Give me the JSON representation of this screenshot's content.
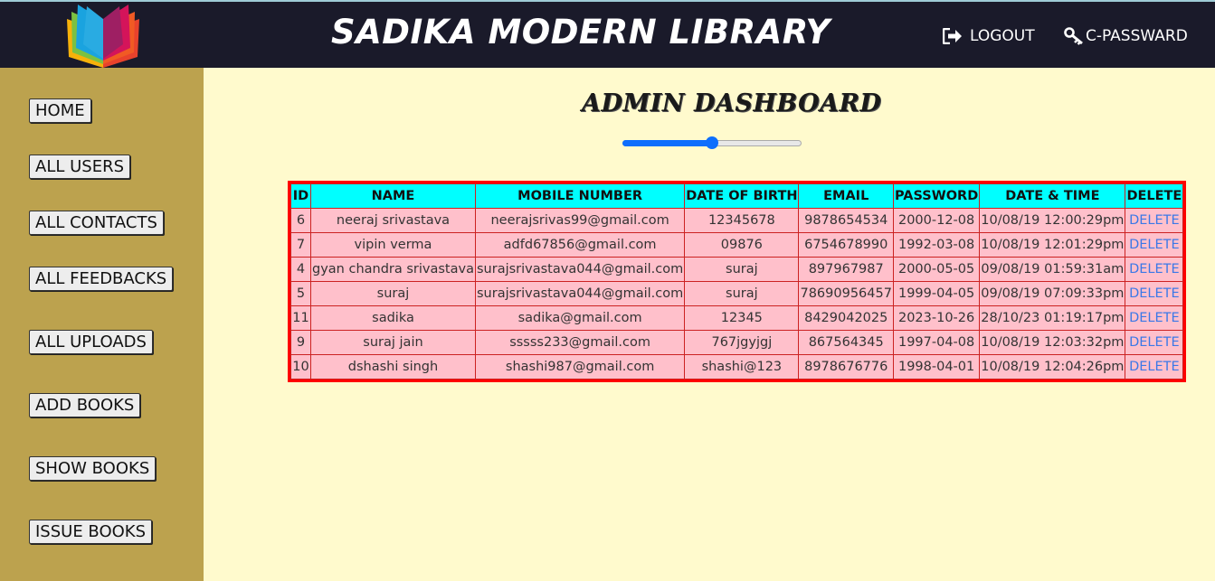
{
  "header": {
    "site_title": "SADIKA MODERN LIBRARY",
    "logout_label": "LOGOUT",
    "change_password_label": "C-PASSWARD"
  },
  "sidebar": {
    "items": [
      {
        "label": "HOME"
      },
      {
        "label": "ALL USERS"
      },
      {
        "label": "ALL CONTACTS"
      },
      {
        "label": "ALL FEEDBACKS"
      },
      {
        "label": "ALL UPLOADS"
      },
      {
        "label": "ADD BOOKS"
      },
      {
        "label": "SHOW BOOKS"
      },
      {
        "label": "ISSUE BOOKS"
      }
    ]
  },
  "main": {
    "title": "ADMIN DASHBOARD",
    "slider_value": 0.5
  },
  "table": {
    "columns": [
      "ID",
      "NAME",
      "MOBILE NUMBER",
      "DATE OF BIRTH",
      "EMAIL",
      "PASSWORD",
      "DATE & TIME",
      "DELETE"
    ],
    "rows": [
      [
        "6",
        "neeraj srivastava",
        "neerajsrivas99@gmail.com",
        "12345678",
        "9878654534",
        "2000-12-08",
        "10/08/19 12:00:29pm",
        "DELETE"
      ],
      [
        "7",
        "vipin verma",
        "adfd67856@gmail.com",
        "09876",
        "6754678990",
        "1992-03-08",
        "10/08/19 12:01:29pm",
        "DELETE"
      ],
      [
        "4",
        "gyan chandra srivastava",
        "surajsrivastava044@gmail.com",
        "suraj",
        "897967987",
        "2000-05-05",
        "09/08/19 01:59:31am",
        "DELETE"
      ],
      [
        "5",
        "suraj",
        "surajsrivastava044@gmail.com",
        "suraj",
        "78690956457",
        "1999-04-05",
        "09/08/19 07:09:33pm",
        "DELETE"
      ],
      [
        "11",
        "sadika",
        "sadika@gmail.com",
        "12345",
        "8429042025",
        "2023-10-26",
        "28/10/23 01:19:17pm",
        "DELETE"
      ],
      [
        "9",
        "suraj jain",
        "sssss233@gmail.com",
        "767jgyjgj",
        "867564345",
        "1997-04-08",
        "10/08/19 12:03:32pm",
        "DELETE"
      ],
      [
        "10",
        "dshashi singh",
        "shashi987@gmail.com",
        "shashi@123",
        "8978676776",
        "1998-04-01",
        "10/08/19 12:04:26pm",
        "DELETE"
      ]
    ]
  },
  "colors": {
    "header_bg": "#1a1a2a",
    "sidebar_bg": "#bca24e",
    "page_bg": "#fffacd",
    "table_header_bg": "#00ffff",
    "table_row_bg": "#ffc0cb",
    "table_border": "#ff0000",
    "delete_link": "#3b78e7",
    "slider_accent": "#0d6efd"
  },
  "icons": {
    "logo": "book-logo-icon",
    "logout": "sign-out-icon",
    "password": "key-icon"
  }
}
